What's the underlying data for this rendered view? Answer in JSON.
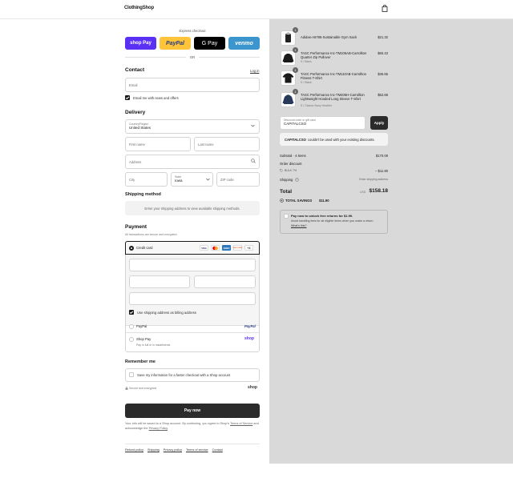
{
  "header": {
    "logo": "ClothingShop"
  },
  "express": {
    "label": "Express checkout",
    "or": "OR",
    "shop_pay": "shop Pay",
    "paypal": "PayPal",
    "gpay": "G Pay",
    "venmo": "venmo"
  },
  "contact": {
    "title": "Contact",
    "login": "Log in",
    "email_placeholder": "Email",
    "news_label": "Email me with news and offers"
  },
  "delivery": {
    "title": "Delivery",
    "country_label": "Country/Region",
    "country_value": "United States",
    "first_name": "First name",
    "last_name": "Last name",
    "address": "Address",
    "city": "City",
    "state_label": "State",
    "state_value": "Iowa",
    "zip": "ZIP code"
  },
  "shipping": {
    "title": "Shipping method",
    "message": "Enter your shipping address to view available shipping methods."
  },
  "payment": {
    "title": "Payment",
    "subtitle": "All transactions are secure and encrypted.",
    "credit_card": "Credit card",
    "cards": [
      "VISA",
      "MC",
      "AMEX",
      "DISCOVER",
      "+4"
    ],
    "billing_same": "Use shipping address as billing address",
    "paypal": "PayPal",
    "paypal_logo": "PayPal",
    "shop_pay": "Shop Pay",
    "shop_pay_sub": "Pay in full or in installments",
    "shop_logo": "shop"
  },
  "remember": {
    "title": "Remember me",
    "save_label": "Save my information for a faster checkout with a Shop account",
    "secure": "Secure and encrypted",
    "shop_logo": "shop"
  },
  "pay_now": "Pay now",
  "legal": {
    "line1": "Your info will be saved to a Shop account. By continuing, you agree to Shop’s",
    "terms": "Terms of Service",
    "and": "and acknowledge the",
    "privacy": "Privacy Policy",
    "period": "."
  },
  "footer_links": [
    "Refund policy",
    "Shipping",
    "Privacy policy",
    "Terms of service",
    "Contact"
  ],
  "cart": {
    "items": [
      {
        "qty": "1",
        "name": "Adidas-A6785-Sustainable Gym Sack",
        "variant": "",
        "price": "$21.32"
      },
      {
        "qty": "1",
        "name": "TASC Performance Inc-TM106AB-Carrollton Quarter Zip Pullover",
        "variant": "S / Black",
        "price": "$60.43"
      },
      {
        "qty": "1",
        "name": "TASC Performance Inc-TM110AB-Carrollton Fitness T-Shirt",
        "variant": "S / Black",
        "price": "$35.65"
      },
      {
        "qty": "1",
        "name": "TASC Performance Inc-TM405H-Carrollton Lightweight Hooded Long Sleeve T-Shirt",
        "variant": "S / Classic Navy Heather",
        "price": "$52.68"
      }
    ],
    "discount_label": "Discount code or gift card",
    "discount_value": "CAPITALCSO",
    "apply": "Apply",
    "error_code": "CAPITALCSO",
    "error_text": "couldn't be used with your existing discounts.",
    "subtotal_label": "Subtotal · 4 items",
    "subtotal": "$170.08",
    "order_discount_label": "Order discount",
    "discount_tag": "BULK 7%",
    "discount_amount": "– $11.90",
    "shipping_label": "Shipping",
    "shipping_value": "Enter shipping address",
    "total_label": "Total",
    "currency": "USD",
    "total": "$158.18",
    "savings_label": "TOTAL SAVINGS",
    "savings": "$11.90",
    "returns_title": "Pay now to unlock free returns for $1.99.",
    "returns_text": "Avoid handling fees for all eligible items when you make a return.",
    "returns_link": "What's this?"
  },
  "colors": {
    "shop_pay": "#5a31f4",
    "paypal": "#ffc439",
    "venmo": "#3d95ce",
    "pay_now": "#2b2b2b",
    "sidebar": "#d9d9d9"
  }
}
